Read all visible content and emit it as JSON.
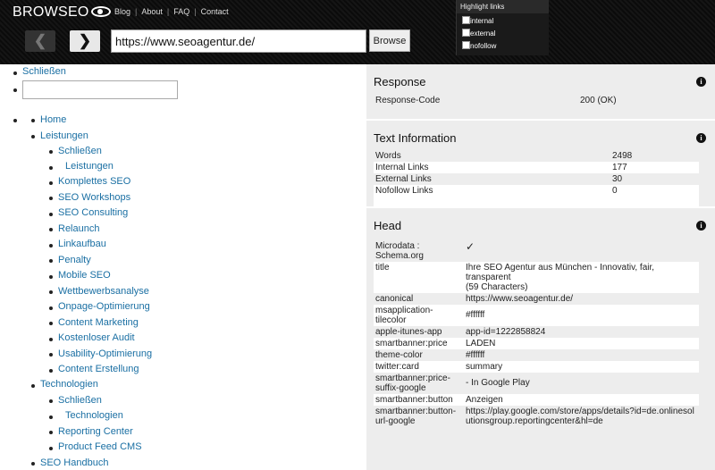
{
  "header": {
    "logo": "BROWSEO",
    "nav": [
      "Blog",
      "About",
      "FAQ",
      "Contact"
    ],
    "url_value": "https://www.seoagentur.de/",
    "browse_label": "Browse",
    "back_glyph": "❮",
    "forward_glyph": "❯"
  },
  "highlight": {
    "title": "Highlight links",
    "options": [
      "internal",
      "external",
      "nofollow"
    ]
  },
  "sidebar": {
    "close_top": "Schließen",
    "home": "Home",
    "leistungen": "Leistungen",
    "schliessen": "Schließen",
    "leistungen_sub": "Leistungen",
    "items": [
      "Komplettes SEO",
      "SEO Workshops",
      "SEO Consulting",
      "Relaunch",
      "Linkaufbau",
      "Penalty",
      "Mobile SEO",
      "Wettbewerbsanalyse",
      "Onpage-Optimierung",
      "Content Marketing",
      "Kostenloser Audit",
      "Usability-Optimierung",
      "Content Erstellung"
    ],
    "technologien": "Technologien",
    "schliessen2": "Schließen",
    "technologien_sub": "Technologien",
    "tech_items": [
      "Reporting Center",
      "Product Feed CMS"
    ],
    "handbuch": "SEO Handbuch"
  },
  "response": {
    "title": "Response",
    "label": "Response-Code",
    "value": "200 (OK)"
  },
  "textinfo": {
    "title": "Text Information",
    "rows": [
      [
        "Words",
        "2498"
      ],
      [
        "Internal Links",
        "177"
      ],
      [
        "External Links",
        "30"
      ],
      [
        "Nofollow Links",
        "0"
      ]
    ]
  },
  "head": {
    "title": "Head",
    "rows": [
      [
        "Microdata : Schema.org",
        "✓"
      ],
      [
        "title",
        "Ihre SEO Agentur aus München - Innovativ, fair, transparent\n(59 Characters)"
      ],
      [
        "canonical",
        "https://www.seoagentur.de/"
      ],
      [
        "msapplication-tilecolor",
        "#ffffff"
      ],
      [
        "apple-itunes-app",
        "app-id=1222858824"
      ],
      [
        "smartbanner:price",
        "LADEN"
      ],
      [
        "theme-color",
        "#ffffff"
      ],
      [
        "twitter:card",
        "summary"
      ],
      [
        "smartbanner:price-suffix-google",
        "- In Google Play"
      ],
      [
        "smartbanner:button",
        "Anzeigen"
      ],
      [
        "smartbanner:button-url-google",
        "https://play.google.com/store/apps/details?id=de.onlinesolutionsgroup.reportingcenter&hl=de"
      ]
    ]
  },
  "info_glyph": "i"
}
